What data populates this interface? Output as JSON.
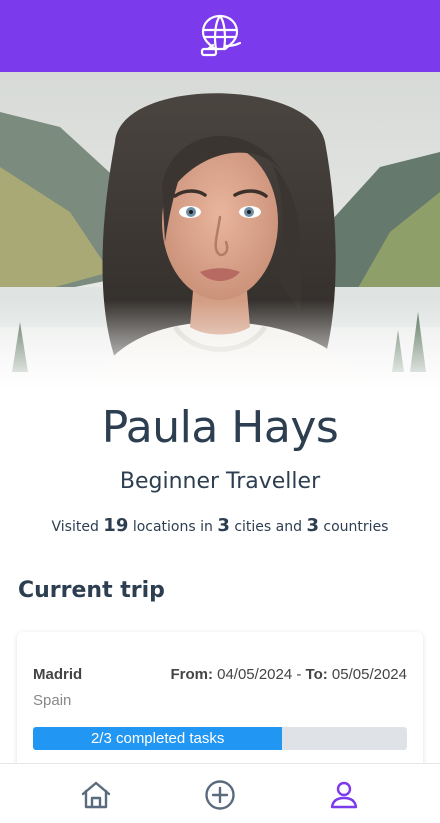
{
  "colors": {
    "brand": "#7c3aed",
    "text_dark": "#2c3e50",
    "progress_fill": "#2196f3",
    "progress_track": "#dfe3e8",
    "nav_icon": "#5a6b7d",
    "nav_active": "#7c3aed"
  },
  "header": {
    "logo_icon": "hot-air-balloon-icon"
  },
  "profile": {
    "photo_alt": "Profile photo of a woman with long brown hair in a white hoodie, mountains behind her",
    "name": "Paula Hays",
    "level": "Beginner Traveller",
    "stats": {
      "prefix": "Visited",
      "locations": "19",
      "locations_text": "locations in",
      "cities": "3",
      "cities_text": "cities and",
      "countries": "3",
      "countries_text": "countries"
    }
  },
  "current_trip": {
    "section_title": "Current trip",
    "city": "Madrid",
    "country": "Spain",
    "from_label": "From:",
    "from_date": "04/05/2024",
    "separator": "-",
    "to_label": "To:",
    "to_date": "05/05/2024",
    "tasks_completed": 2,
    "tasks_total": 3,
    "progress_label": "2/3 completed tasks"
  },
  "bottom_nav": {
    "items": [
      {
        "icon": "home-icon",
        "active": false
      },
      {
        "icon": "plus-circle-icon",
        "active": false
      },
      {
        "icon": "user-icon",
        "active": true
      }
    ]
  }
}
